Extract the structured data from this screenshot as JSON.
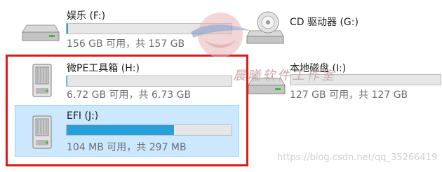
{
  "drives": [
    {
      "id": "F",
      "name": "娱乐 (F:)",
      "size_text": "156 GB 可用，共 157 GB",
      "used_fraction": 0.01,
      "icon": "hard-disk-icon",
      "selected": false
    },
    {
      "id": "G",
      "name": "CD 驱动器 (G:)",
      "size_text": "",
      "used_fraction": null,
      "icon": "cd-drive-icon",
      "selected": false
    },
    {
      "id": "H",
      "name": "微PE工具箱 (H:)",
      "size_text": "6.72 GB 可用，共 6.73 GB",
      "used_fraction": 0.002,
      "icon": "removable-drive-icon",
      "selected": false
    },
    {
      "id": "I",
      "name": "本地磁盘 (I:)",
      "size_text": "127 GB 可用，共 127 GB",
      "used_fraction": 0.0,
      "icon": "hard-disk-icon",
      "selected": false
    },
    {
      "id": "J",
      "name": "EFI (J:)",
      "size_text": "104 MB 可用，共 297 MB",
      "used_fraction": 0.65,
      "icon": "removable-drive-icon",
      "selected": true
    }
  ],
  "watermark": {
    "text": "晨曦软件工作室",
    "blog": "https://blog.csdn.net/qq_35266419"
  },
  "colors": {
    "accent": "#26a0da",
    "selection": "#cce8ff",
    "highlight_box": "#e01818"
  }
}
